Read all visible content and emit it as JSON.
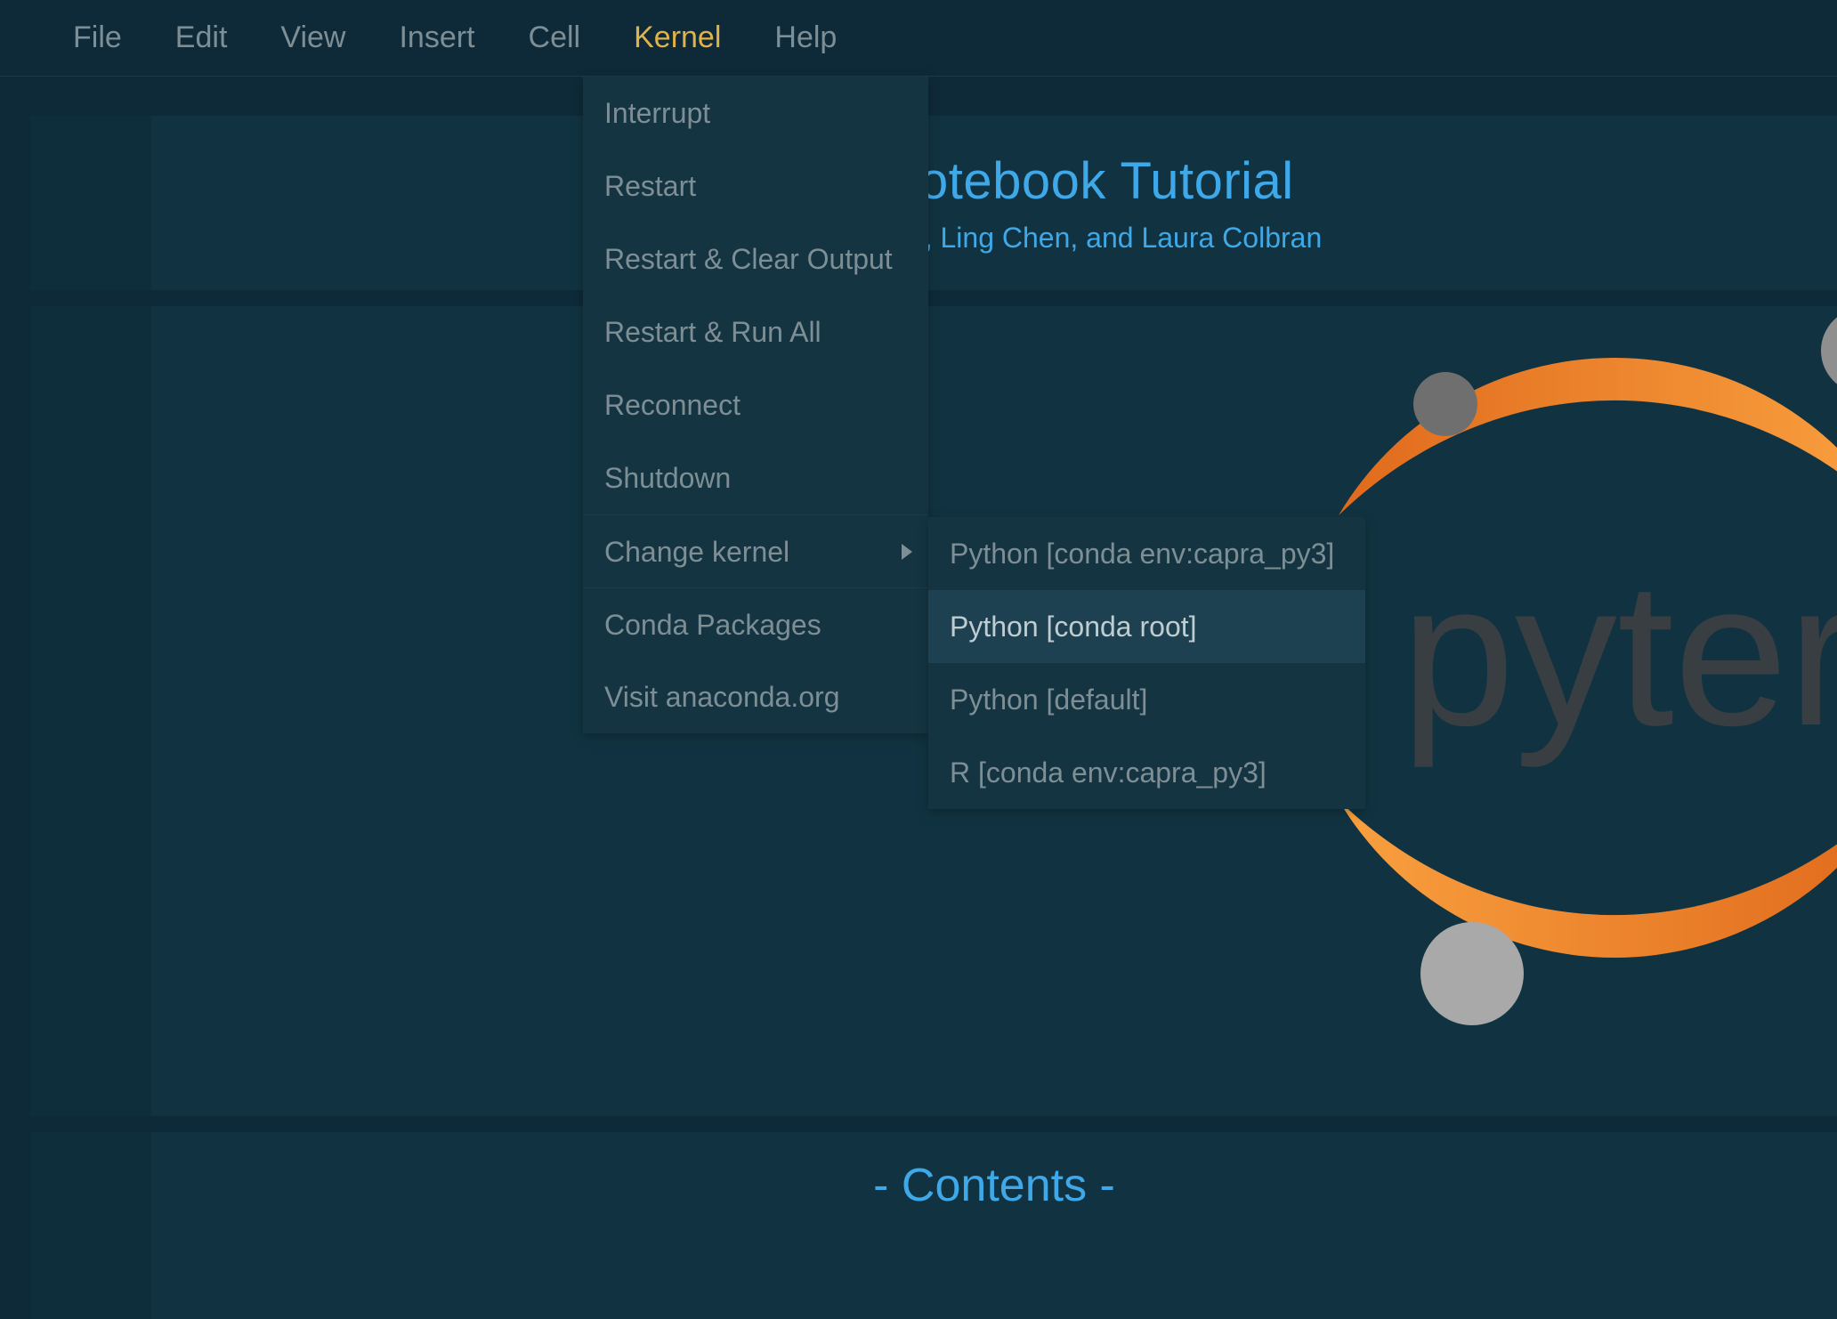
{
  "menubar": {
    "items": [
      "File",
      "Edit",
      "View",
      "Insert",
      "Cell",
      "Kernel",
      "Help"
    ],
    "active_index": 5
  },
  "kernel_menu": {
    "items": [
      {
        "label": "Interrupt"
      },
      {
        "label": "Restart"
      },
      {
        "label": "Restart & Clear Output"
      },
      {
        "label": "Restart & Run All"
      },
      {
        "label": "Reconnect"
      },
      {
        "label": "Shutdown"
      },
      {
        "label": "Change kernel",
        "has_submenu": true,
        "sep_above": true
      },
      {
        "label": "Conda Packages",
        "sep_above": true
      },
      {
        "label": "Visit anaconda.org"
      }
    ]
  },
  "change_kernel_submenu": {
    "items": [
      {
        "label": "Python [conda env:capra_py3]"
      },
      {
        "label": "Python [conda root]",
        "hover": true
      },
      {
        "label": "Python [default]"
      },
      {
        "label": "R [conda env:capra_py3]"
      }
    ]
  },
  "notebook": {
    "title": "Jupyter Notebook Tutorial",
    "authors": "Mary Lauren Benton, Ling Chen, and Laura Colbran",
    "logo_word": "pyter",
    "contents_heading": "- Contents -"
  },
  "colors": {
    "accent_link": "#3fa8e8",
    "menu_active": "#e0b24a",
    "logo_orange_light": "#f9a03f",
    "logo_orange_dark": "#e06a1c",
    "logo_grey_light": "#a9a9a9",
    "logo_grey_dark": "#6f6f6f",
    "logo_text": "#5a4744"
  }
}
